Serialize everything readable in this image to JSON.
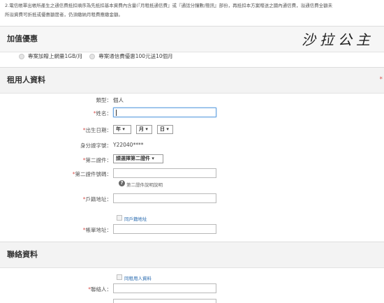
{
  "notice": {
    "line1": "2.電信帳單出帳所產生之通信費抵扣順序為先抵扣基本資費內含量(『月租抵通信費』或『通話分鐘數/簡訊』部份，再抵扣本方案贈送之國內通信費，溢通信費全額未",
    "line2": "所溢資費可折抵或優惠額度者，仍須繳納月租費應繳金額。"
  },
  "promo": {
    "title": "加值優惠",
    "options": [
      "專案加贈上網量1GB/月",
      "專案通信費優惠100元送10個月"
    ]
  },
  "signature": "沙拉公主",
  "renter": {
    "title": "租用人資料",
    "marker": "*",
    "type_label": "類型：",
    "type_value": "個人",
    "name_label": "姓名：",
    "birth_label": "出生日期：",
    "year": "年 ▾",
    "month": "月 ▾",
    "day": "日 ▾",
    "id_label": "身分證字號：",
    "id_value": "Y22040****",
    "doc2_label": "第二證件：",
    "doc2_select": "請選擇第二證件 ▾",
    "doc2_no_label": "第二證件號碼：",
    "doc2_help": "第二證件說明說明",
    "household_label": "戶籍地址：",
    "same_address": "同戶籍地址",
    "mail_label": "帳單地址："
  },
  "contact": {
    "title": "聯絡資料",
    "same_renter": "同租用人資料",
    "contact_label": "聯絡人："
  },
  "required_mark": "*"
}
